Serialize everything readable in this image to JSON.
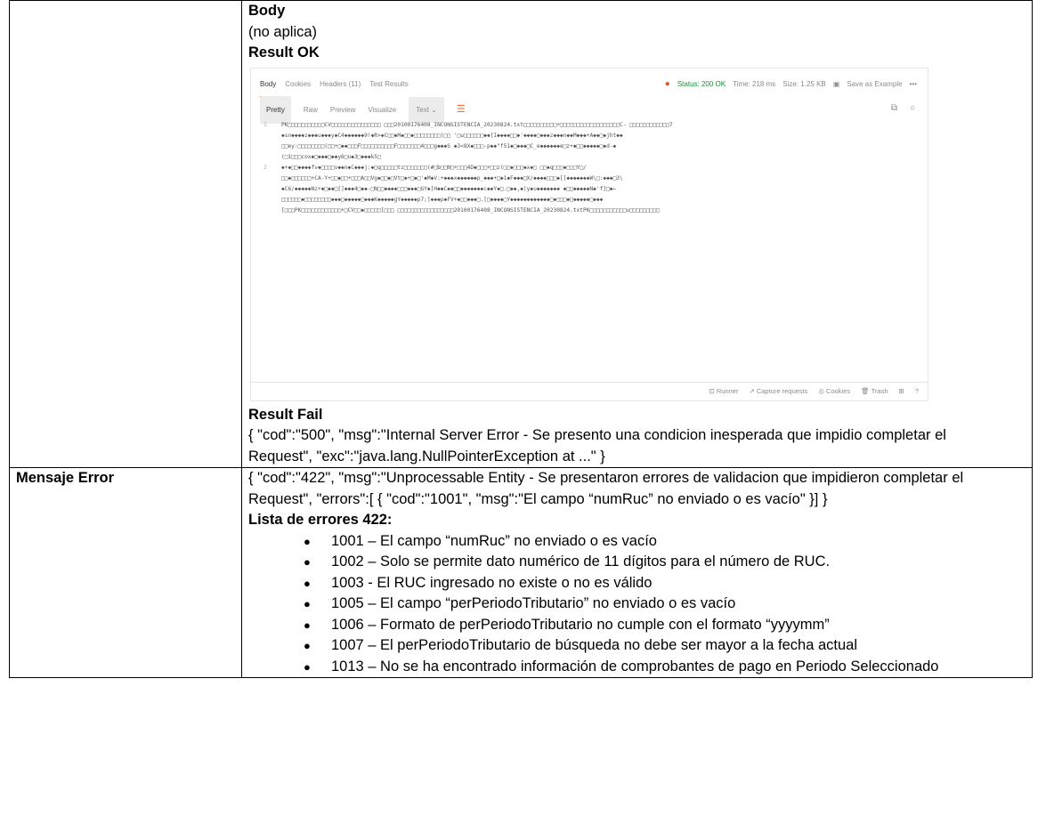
{
  "request": {
    "body_heading": "Body",
    "body_value": "(no aplica)",
    "ok_heading": "Result OK",
    "fail_heading": "Result Fail",
    "fail_json": "{ \"cod\":\"500\", \"msg\":\"Internal Server Error - Se presento una condicion inesperada que impidio completar el Request\", \"exc\":\"java.lang.NullPointerException at ...\" }"
  },
  "screenshot": {
    "tabs": [
      "Body",
      "Cookies",
      "Headers (11)",
      "Test Results"
    ],
    "status": "Status: 200 OK",
    "time": "Time: 218 ms",
    "size": "Size: 1.25 KB",
    "save": "Save as Example",
    "view_tabs": [
      "Pretty",
      "Raw",
      "Preview",
      "Visualize"
    ],
    "format": "Text",
    "line1_label": "1",
    "line1": [
      "PK□□□□□□□□□□□CV□□□□□□□□□□□□□□□ □□□20100176408_INCONSISTENCIA_20230824.txt□□□□□□□□□□+□□□□□□□□□□□□□□□□□□C-   □□□□□□□□□□□□7",
      "◆sn◆◆◆◆z◆◆◆u◆◆◆y◆C4◆◆◆◆◆◆9!◆R>◆C□□◆M◆□□◆□□□□□□□□(□□ '□u□□□□□□◆◆[I◆◆◆◆□□◆'◆◆◆◆□◆◆◆z◆◆◆n◆◆M◆◆◆+A◆◆□◆jht◆◆",
      "□□ey:□□□□□□□□(□□+□◆◆□□□F□□□□□□□□□□F□□□□□□□4□□□g◆◆◆S  ◆3<8X◆□□□-p◆◆\"f51◆□◆◆◆□C_e◆◆◆◆◆◆e□z+◆□□◆◆◆◆◆□◆d-◆",
      "(□1□□□cox◆□◆◆◆□◆◆y6□u◆3□◆◆◆k5□"
    ],
    "line2_label": "2",
    "line2": [
      "◆+◆□□◆◆◆◆fv◆□□□□v◆◆n◆C◆◆◆j:◆□q□□□□□tz□□□□□□□(#□b□□N□+□□□4D◆□□□+□□z(□□◆□□□◆x◆□ □□◆q□□□◆□□□Y□/",
      "□□◆□□□□□□+CA-Y+□□◆□□+□□□A□□Vg◆□□◆□Vt□◆+□◆□'◆M◆V:+◆◆◆x◆◆◆◆◆◆p_◆◆◆+□◆1◆F◆◆◆□X/◆◆◆◆□□□◆[]◆◆◆◆◆◆◆W\\□:◆◆◆□3\\",
      "◆C6/◆◆◆◆◆Nz+◆□◆◆□[]◆◆◆4□◆◆-□N□□◆◆◆◆□□□◆◆◆□GY◆]H◆◆C◆◆□□◆◆◆◆◆◆◆c◆◆Y◆□.□◆◆,◆|y◆u◆◆◆◆◆◆◆  ◆□□◆◆◆◆◆N◆'f]□◆←",
      "□□□□□□◆□□□□□□□□◆◆◆□◆◆◆◆◆□◆◆◆K◆◆◆◆◆gY◆◆◆◆◆p7;]◆◆◆p◆FV+◆□□◆◆◆□.[□◆◆◆◆□Y◆◆◆◆◆◆◆◆◆◆◆◆□◆□□□◆□◆◆◆◆◆□◆◆◆",
      "[□□□PK□□□□□□□□□□□□+□CV□□◆□□□□□[□□□ □□□□□□□□□□□□□□□□□20100176408_INCONSISTENCIA_20230824.txtPK□□□□□□□□□□□u□□□□□□□□□"
    ],
    "footer": [
      "Runner",
      "Capture requests",
      "Cookies",
      "Trash"
    ]
  },
  "error": {
    "label": "Mensaje Error",
    "json": "{ \"cod\":\"422\", \"msg\":\"Unprocessable Entity - Se presentaron errores de validacion que impidieron completar el Request\", \"errors\":[ { \"cod\":\"1001\", \"msg\":\"El campo “numRuc” no enviado o es vacío\" }] }",
    "list_heading": "Lista de errores 422:",
    "items": [
      "1001 – El campo “numRuc” no enviado o es vacío",
      "1002 – Solo se permite dato numérico de 11 dígitos para el número de RUC.",
      "1003 - El RUC ingresado no existe o no es válido",
      "1005 – El campo “perPeriodoTributario” no enviado o es vacío",
      "1006 – Formato de perPeriodoTributario no cumple con el formato “yyyymm”",
      "1007 – El perPeriodoTributario de búsqueda no debe ser mayor a la fecha actual",
      "1013 – No se ha encontrado información de comprobantes de pago en Periodo Seleccionado"
    ]
  }
}
